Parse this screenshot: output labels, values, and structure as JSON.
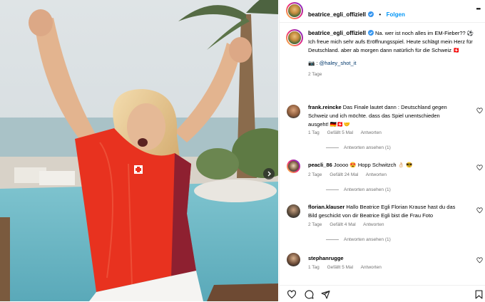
{
  "post": {
    "username": "beatrice_egli_offiziell",
    "follow_label": "Folgen",
    "more_label": "•••",
    "caption_line1": "Na. wer ist noch alles im EM-Fieber?? ⚽",
    "caption_line2": "Ich freue mich sehr aufs Eröffnungsspiel. Heute schlägt mein Herz für Deutschland. aber ab morgen dann natürlich für die Schweiz 🇨🇭",
    "photo_credit_icon": "📷",
    "photo_credit_sep": ":",
    "photo_credit": "@haley_shot_it",
    "age": "2 Tage"
  },
  "comments": [
    {
      "user": "frank.reincke",
      "text": "Das Finale lautet dann : Deutschland gegen Schweiz und ich möchte. dass das Spiel unentschieden ausgeht! 🇩🇪🇨🇭🤝",
      "age": "1 Tag",
      "likes": "Gefällt 5 Mal",
      "reply": "Antworten",
      "replies": "Antworten ansehen (1)"
    },
    {
      "user": "peacli_86",
      "text": "Joooo 😍 Hopp Schwitzch 👌🏻 😎",
      "age": "2 Tage",
      "likes": "Gefällt 24 Mal",
      "reply": "Antworten",
      "replies": "Antworten ansehen (1)"
    },
    {
      "user": "florian.klauser",
      "text": "Hallo Beatrice Egli Florian Krause hast du das Bild geschickt von dir Beatrice Egli bist die Frau Foto",
      "age": "2 Tage",
      "likes": "Gefällt 4 Mal",
      "reply": "Antworten",
      "replies": "Antworten ansehen (1)"
    },
    {
      "user": "stephanrugge",
      "text": "",
      "age": "1 Tag",
      "likes": "Gefällt 5 Mal",
      "reply": "Antworten"
    }
  ],
  "icons": {
    "verified": "verified-badge-icon",
    "heart": "heart-icon",
    "comment": "comment-icon",
    "share": "share-icon",
    "save": "bookmark-icon",
    "next": "chevron-right-icon"
  },
  "colors": {
    "accent": "#0095f6",
    "verified": "#3897f0",
    "jersey": "#e8321f"
  }
}
